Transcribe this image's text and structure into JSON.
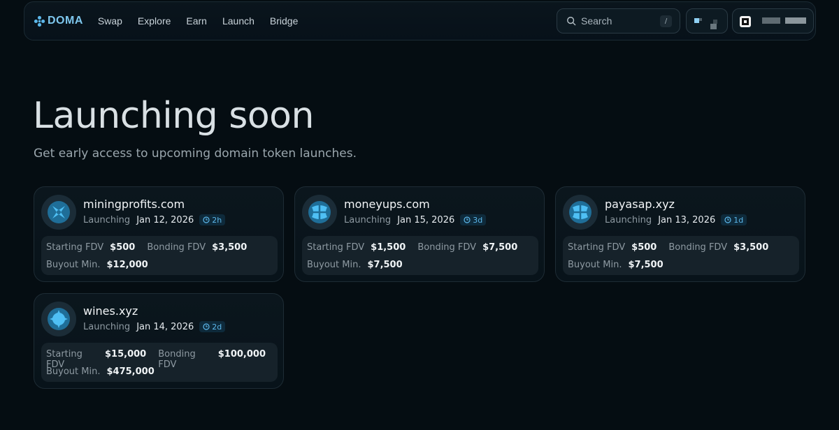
{
  "nav": {
    "brand": "DOMA",
    "links": [
      "Swap",
      "Explore",
      "Earn",
      "Launch",
      "Bridge"
    ],
    "search_label": "Search",
    "search_shortcut": "/"
  },
  "page": {
    "title": "Launching soon",
    "subtitle": "Get early access to upcoming domain token launches."
  },
  "cards": [
    {
      "domain": "miningprofits.com",
      "status": "Launching",
      "date": "Jan 12, 2026",
      "countdown": "2h",
      "starting_fdv_label": "Starting FDV",
      "starting_fdv": "$500",
      "bonding_fdv_label": "Bonding FDV",
      "bonding_fdv": "$3,500",
      "buyout_label": "Buyout Min.",
      "buyout": "$12,000"
    },
    {
      "domain": "moneyups.com",
      "status": "Launching",
      "date": "Jan 15, 2026",
      "countdown": "3d",
      "starting_fdv_label": "Starting FDV",
      "starting_fdv": "$1,500",
      "bonding_fdv_label": "Bonding FDV",
      "bonding_fdv": "$7,500",
      "buyout_label": "Buyout Min.",
      "buyout": "$7,500"
    },
    {
      "domain": "payasap.xyz",
      "status": "Launching",
      "date": "Jan 13, 2026",
      "countdown": "1d",
      "starting_fdv_label": "Starting FDV",
      "starting_fdv": "$500",
      "bonding_fdv_label": "Bonding FDV",
      "bonding_fdv": "$3,500",
      "buyout_label": "Buyout Min.",
      "buyout": "$7,500"
    },
    {
      "domain": "wines.xyz",
      "status": "Launching",
      "date": "Jan 14, 2026",
      "countdown": "2d",
      "starting_fdv_label": "Starting FDV",
      "starting_fdv": "$15,000",
      "bonding_fdv_label": "Bonding FDV",
      "bonding_fdv": "$100,000",
      "buyout_label": "Buyout Min.",
      "buyout": "$475,000"
    }
  ],
  "colors": {
    "background": "#050d12",
    "accent": "#5cb7ea",
    "brand": "#7ec7ee",
    "card_border": "#1e2c35"
  },
  "icons": {
    "brand": "doma-logo-icon",
    "search": "search-icon",
    "avatar": "domain-token-icon",
    "badge": "clock-icon"
  }
}
